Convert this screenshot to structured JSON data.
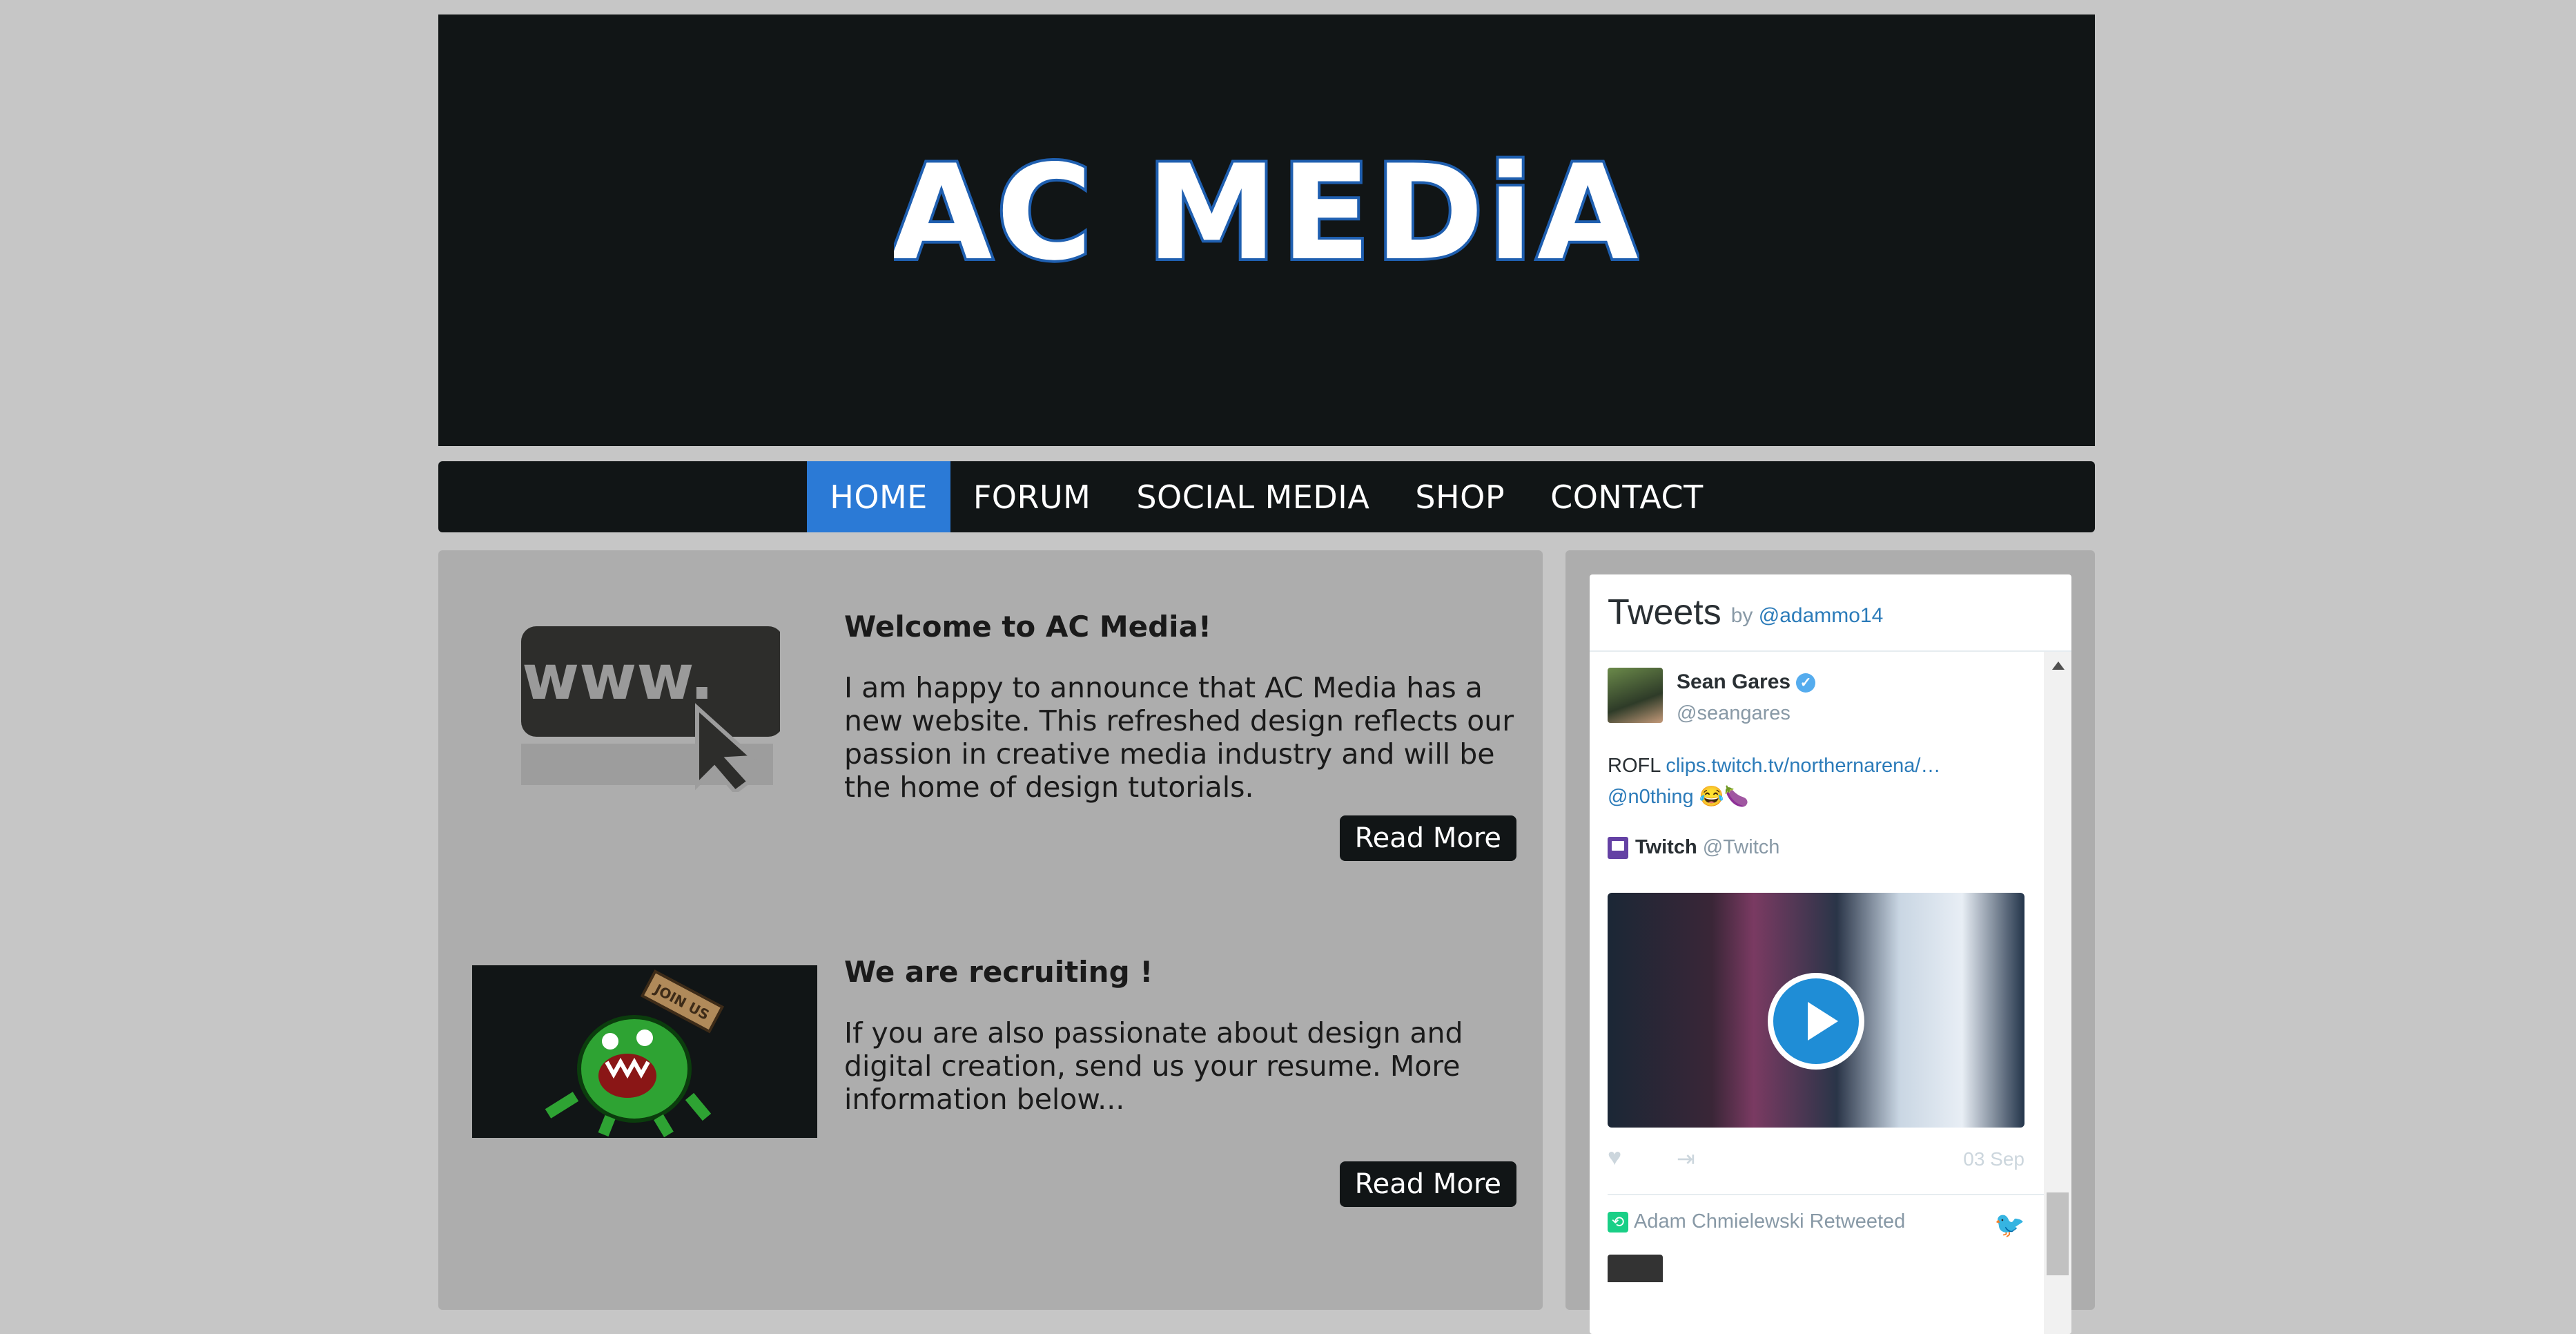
{
  "banner": {
    "logo_text": "AC MEDiA"
  },
  "nav": {
    "items": [
      {
        "label": "HOME",
        "active": true
      },
      {
        "label": "FORUM",
        "active": false
      },
      {
        "label": "SOCIAL MEDIA",
        "active": false
      },
      {
        "label": "SHOP",
        "active": false
      },
      {
        "label": "CONTACT",
        "active": false
      }
    ]
  },
  "posts": [
    {
      "title": "Welcome to AC Media!",
      "body": "I am happy to announce that AC Media has a new website. This refreshed design reflects our passion in creative media industry and will be the home of design tutorials.",
      "thumb_text": "www.",
      "button": "Read More"
    },
    {
      "title": "We are recruiting !",
      "body": "If you are also passionate about design and digital creation, send us your resume. More information below...",
      "thumb_text": "JOIN US",
      "button": "Read More"
    }
  ],
  "tweets": {
    "title": "Tweets",
    "by": "by",
    "handle": "@adammo14",
    "tweet": {
      "name": "Sean Gares",
      "handle": "@seangares",
      "text_prefix": "ROFL",
      "link": "clips.twitch.tv/northernarena/…",
      "mention": "@n0thing",
      "emojis": "😂🍆",
      "card_name": "Twitch",
      "card_handle": "@Twitch",
      "date": "03 Sep"
    },
    "retweet_label": "Adam Chmielewski Retweeted"
  },
  "colors": {
    "background": "#c6c6c6",
    "dark": "#111516",
    "accent": "#2b7ad6",
    "panel": "#adadad"
  }
}
